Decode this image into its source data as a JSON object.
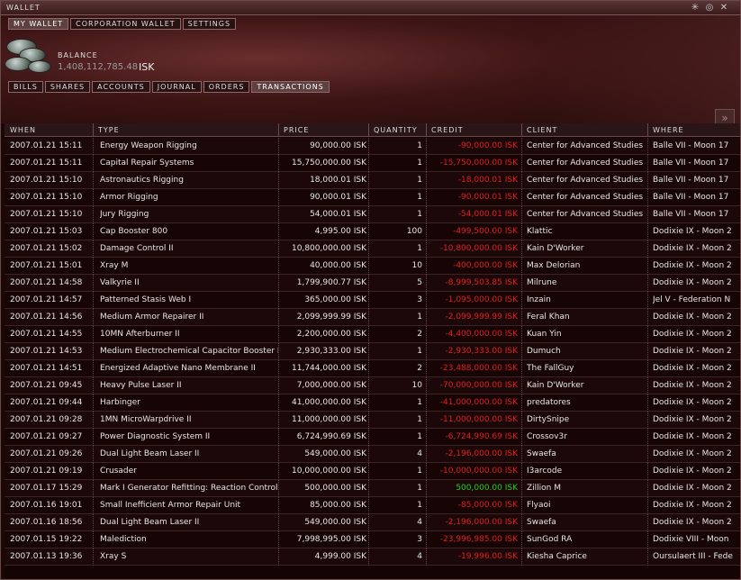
{
  "window": {
    "title": "WALLET"
  },
  "main_tabs": [
    {
      "label": "MY WALLET",
      "active": true
    },
    {
      "label": "CORPORATION WALLET",
      "active": false
    },
    {
      "label": "SETTINGS",
      "active": false
    }
  ],
  "balance": {
    "label": "BALANCE",
    "value": "1,408,112,785.48",
    "unit": "ISK"
  },
  "sub_tabs": [
    {
      "label": "BILLS",
      "active": false
    },
    {
      "label": "SHARES",
      "active": false
    },
    {
      "label": "ACCOUNTS",
      "active": false
    },
    {
      "label": "JOURNAL",
      "active": false
    },
    {
      "label": "ORDERS",
      "active": false
    },
    {
      "label": "TRANSACTIONS",
      "active": true
    }
  ],
  "columns": [
    "WHEN",
    "TYPE",
    "PRICE",
    "QUANTITY",
    "CREDIT",
    "CLIENT",
    "WHERE"
  ],
  "rows": [
    {
      "when": "2007.01.21 15:11",
      "type": "Energy Weapon Rigging",
      "price": "90,000.00 ISK",
      "qty": "1",
      "credit": "-90,000.00 ISK",
      "client": "Center for Advanced Studies",
      "where": "Balle VII - Moon 17"
    },
    {
      "when": "2007.01.21 15:11",
      "type": "Capital Repair Systems",
      "price": "15,750,000.00 ISK",
      "qty": "1",
      "credit": "-15,750,000.00 ISK",
      "client": "Center for Advanced Studies",
      "where": "Balle VII - Moon 17"
    },
    {
      "when": "2007.01.21 15:10",
      "type": "Astronautics Rigging",
      "price": "18,000.01 ISK",
      "qty": "1",
      "credit": "-18,000.01 ISK",
      "client": "Center for Advanced Studies",
      "where": "Balle VII - Moon 17"
    },
    {
      "when": "2007.01.21 15:10",
      "type": "Armor Rigging",
      "price": "90,000.01 ISK",
      "qty": "1",
      "credit": "-90,000.01 ISK",
      "client": "Center for Advanced Studies",
      "where": "Balle VII - Moon 17"
    },
    {
      "when": "2007.01.21 15:10",
      "type": "Jury Rigging",
      "price": "54,000.01 ISK",
      "qty": "1",
      "credit": "-54,000.01 ISK",
      "client": "Center for Advanced Studies",
      "where": "Balle VII - Moon 17"
    },
    {
      "when": "2007.01.21 15:03",
      "type": "Cap Booster 800",
      "price": "4,995.00 ISK",
      "qty": "100",
      "credit": "-499,500.00 ISK",
      "client": "Klattic",
      "where": "Dodixie IX - Moon 2"
    },
    {
      "when": "2007.01.21 15:02",
      "type": "Damage Control II",
      "price": "10,800,000.00 ISK",
      "qty": "1",
      "credit": "-10,800,000.00 ISK",
      "client": "Kain D'Worker",
      "where": "Dodixie IX - Moon 2"
    },
    {
      "when": "2007.01.21 15:01",
      "type": "Xray M",
      "price": "40,000.00 ISK",
      "qty": "10",
      "credit": "-400,000.00 ISK",
      "client": "Max Delorian",
      "where": "Dodixie IX - Moon 2"
    },
    {
      "when": "2007.01.21 14:58",
      "type": "Valkyrie II",
      "price": "1,799,900.77 ISK",
      "qty": "5",
      "credit": "-8,999,503.85 ISK",
      "client": "Milrune",
      "where": "Dodixie IX - Moon 2"
    },
    {
      "when": "2007.01.21 14:57",
      "type": "Patterned Stasis Web I",
      "price": "365,000.00 ISK",
      "qty": "3",
      "credit": "-1,095,000.00 ISK",
      "client": "Inzain",
      "where": "Jel V - Federation N"
    },
    {
      "when": "2007.01.21 14:56",
      "type": "Medium Armor Repairer II",
      "price": "2,099,999.99 ISK",
      "qty": "1",
      "credit": "-2,099,999.99 ISK",
      "client": "Feral Khan",
      "where": "Dodixie IX - Moon 2"
    },
    {
      "when": "2007.01.21 14:55",
      "type": "10MN Afterburner II",
      "price": "2,200,000.00 ISK",
      "qty": "2",
      "credit": "-4,400,000.00 ISK",
      "client": "Kuan Yin",
      "where": "Dodixie IX - Moon 2"
    },
    {
      "when": "2007.01.21 14:53",
      "type": "Medium Electrochemical Capacitor Booster I",
      "price": "2,930,333.00 ISK",
      "qty": "1",
      "credit": "-2,930,333.00 ISK",
      "client": "Dumuch",
      "where": "Dodixie IX - Moon 2"
    },
    {
      "when": "2007.01.21 14:51",
      "type": "Energized Adaptive Nano Membrane II",
      "price": "11,744,000.00 ISK",
      "qty": "2",
      "credit": "-23,488,000.00 ISK",
      "client": "The FallGuy",
      "where": "Dodixie IX - Moon 2"
    },
    {
      "when": "2007.01.21 09:45",
      "type": "Heavy Pulse Laser II",
      "price": "7,000,000.00 ISK",
      "qty": "10",
      "credit": "-70,000,000.00 ISK",
      "client": "Kain D'Worker",
      "where": "Dodixie IX - Moon 2"
    },
    {
      "when": "2007.01.21 09:44",
      "type": "Harbinger",
      "price": "41,000,000.00 ISK",
      "qty": "1",
      "credit": "-41,000,000.00 ISK",
      "client": "predatores",
      "where": "Dodixie IX - Moon 2"
    },
    {
      "when": "2007.01.21 09:28",
      "type": "1MN MicroWarpdrive II",
      "price": "11,000,000.00 ISK",
      "qty": "1",
      "credit": "-11,000,000.00 ISK",
      "client": "DirtySnipe",
      "where": "Dodixie IX - Moon 2"
    },
    {
      "when": "2007.01.21 09:27",
      "type": "Power Diagnostic System II",
      "price": "6,724,990.69 ISK",
      "qty": "1",
      "credit": "-6,724,990.69 ISK",
      "client": "Crossov3r",
      "where": "Dodixie IX - Moon 2"
    },
    {
      "when": "2007.01.21 09:26",
      "type": "Dual Light Beam Laser II",
      "price": "549,000.00 ISK",
      "qty": "4",
      "credit": "-2,196,000.00 ISK",
      "client": "Swaefa",
      "where": "Dodixie IX - Moon 2"
    },
    {
      "when": "2007.01.21 09:19",
      "type": "Crusader",
      "price": "10,000,000.00 ISK",
      "qty": "1",
      "credit": "-10,000,000.00 ISK",
      "client": "I3arcode",
      "where": "Dodixie IX - Moon 2"
    },
    {
      "when": "2007.01.17 15:29",
      "type": "Mark I Generator Refitting: Reaction Control",
      "price": "500,000.00 ISK",
      "qty": "1",
      "credit": "500,000.00 ISK",
      "client": "Zillion M",
      "where": "Dodixie IX - Moon 2"
    },
    {
      "when": "2007.01.16 19:01",
      "type": "Small Inefficient Armor Repair Unit",
      "price": "85,000.00 ISK",
      "qty": "1",
      "credit": "-85,000.00 ISK",
      "client": "Flyaoi",
      "where": "Dodixie IX - Moon 2"
    },
    {
      "when": "2007.01.16 18:56",
      "type": "Dual Light Beam Laser II",
      "price": "549,000.00 ISK",
      "qty": "4",
      "credit": "-2,196,000.00 ISK",
      "client": "Swaefa",
      "where": "Dodixie IX - Moon 2"
    },
    {
      "when": "2007.01.15 19:22",
      "type": "Malediction",
      "price": "7,998,995.00 ISK",
      "qty": "3",
      "credit": "-23,996,985.00 ISK",
      "client": "SunGod RA",
      "where": "Dodixie VIII - Moon"
    },
    {
      "when": "2007.01.13 19:36",
      "type": "Xray S",
      "price": "4,999.00 ISK",
      "qty": "4",
      "credit": "-19,996.00 ISK",
      "client": "Kiesha Caprice",
      "where": "Oursulaert III - Fede"
    }
  ],
  "colors": {
    "negative": "#e02020",
    "positive": "#20d020"
  },
  "icons": {
    "expand": "double-chevron-right-icon",
    "pin": "pin-icon",
    "minimize": "minimize-icon",
    "close": "close-icon"
  }
}
